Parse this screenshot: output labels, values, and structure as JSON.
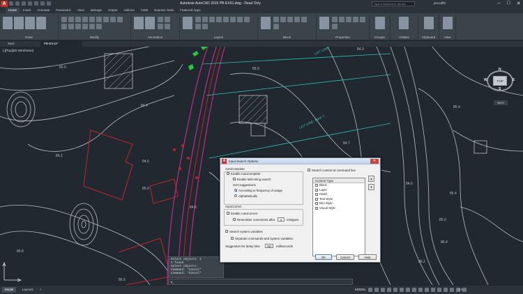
{
  "app": {
    "logo": "A",
    "title": "Autodesk AutoCAD 2016    PB-EX41.dwg - Read Only",
    "search_placeholder": "Type a keyword or phrase",
    "user": "pmsuffth"
  },
  "ribbon": {
    "tabs": [
      "Home",
      "Insert",
      "Annotate",
      "Parametric",
      "View",
      "Manage",
      "Output",
      "Add-ins",
      "A360",
      "Express Tools",
      "Featured Apps"
    ],
    "active_tab": "Home",
    "panels": [
      "Draw",
      "Modify",
      "Annotation",
      "Layers",
      "Block",
      "Properties",
      "Groups",
      "Utilities",
      "Clipboard",
      "View"
    ]
  },
  "doc_tabs": {
    "start": "Start",
    "file": "PB-EX41*"
  },
  "viewport": {
    "label": "[-][Top][2D Wireframe]",
    "viewcube": {
      "top": "TOP",
      "n": "N",
      "s": "S",
      "e": "E",
      "w": "W",
      "wcs": "WCS"
    },
    "spot_labels": [
      "84.3",
      "85.9",
      "85.0",
      "84.4",
      "84.7",
      "85.4",
      "84.6",
      "84.6",
      "86.1",
      "85.0",
      "85.4",
      "84.8",
      "85.8",
      "85.0",
      "86.4",
      "86.5",
      "86.2"
    ],
    "text_labels": [
      "LOT LINE, MAP 7",
      "LOT LINE"
    ],
    "colors": {
      "background": "#212830",
      "contour": "#b9bec4",
      "property": "#c4232b",
      "road": "#cc2d8f",
      "cyan": "#2fbfbf",
      "green": "#27c83a"
    }
  },
  "command": {
    "history": [
      "Select objects: 1",
      "1 found",
      "Select objects:",
      "Command: *Cancel*",
      "Command: *Cancel*"
    ],
    "prompt": "▸_"
  },
  "dialog": {
    "title": "Input Search Options",
    "autocomplete_header": "AutoComplete",
    "enable_autocomplete": "Enable AutoComplete",
    "enable_midstring": "Enable Mid-string search",
    "sort_header": "Sort suggestions",
    "sort_frequency": "According to frequency of usage",
    "sort_alpha": "Alphabetically",
    "autocorrect_header": "AutoCorrect",
    "enable_autocorrect": "Enable AutoCorrect",
    "remember_prefix": "Remember corrections after",
    "remember_value": "3",
    "remember_suffix": "mistypes",
    "search_system_vars": "Search system variables",
    "separate_commands": "Separate commands and system variables",
    "delay_label": "Suggestion list delay time",
    "delay_value": "300",
    "delay_unit": "milliseconds",
    "search_content": "Search content at command line",
    "content_type_header": "Content Type",
    "content_types": [
      "Block",
      "Layer",
      "Hatch",
      "Text Style",
      "Dim Style",
      "Visual Style"
    ],
    "up_arrow": "▲",
    "down_arrow": "▼",
    "ok": "OK",
    "cancel": "Cancel",
    "help": "Help",
    "close": "✕"
  },
  "status": {
    "model_tab": "Model",
    "layout1_tab": "Layout1",
    "add_tab": "+",
    "model_label": "MODEL",
    "scale": "1:1"
  }
}
